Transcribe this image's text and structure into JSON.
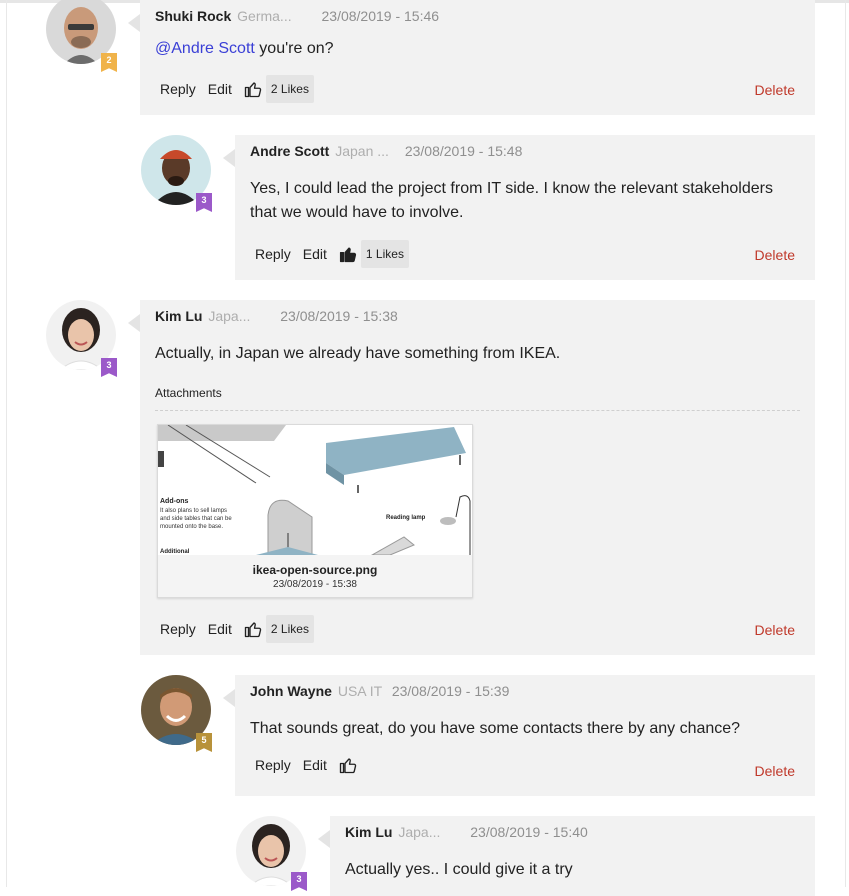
{
  "comments": [
    {
      "author": "Shuki Rock",
      "location": "Germa...",
      "date": "23/08/2019 - 15:46",
      "badge": "2",
      "mention": "@Andre Scott",
      "text": " you're on?",
      "reply": "Reply",
      "edit": "Edit",
      "likes": "2 Likes",
      "delete": "Delete"
    },
    {
      "author": "Andre Scott",
      "location": "Japan ...",
      "date": "23/08/2019 - 15:48",
      "badge": "3",
      "text_line1": "Yes, I could lead the project from IT side. I know the relevant stakeholders",
      "text_line2": "that we would have to involve.",
      "reply": "Reply",
      "edit": "Edit",
      "likes": "1 Likes",
      "delete": "Delete"
    },
    {
      "author": "Kim Lu",
      "location": "Japa...",
      "date": "23/08/2019 - 15:38",
      "badge": "3",
      "text": "Actually, in Japan we already have something from IKEA.",
      "attachments_label": "Attachments",
      "attachment": {
        "file_name": "ikea-open-source.png",
        "file_date": "23/08/2019 - 15:38",
        "thumb_addons_title": "Add-ons",
        "thumb_addons_line1": "It also plans to sell lamps",
        "thumb_addons_line2": "and side tables that can be",
        "thumb_addons_line3": "mounted onto the base.",
        "thumb_additional": "Additional",
        "thumb_reading_lamp": "Reading lamp"
      },
      "reply": "Reply",
      "edit": "Edit",
      "likes": "2 Likes",
      "delete": "Delete"
    },
    {
      "author": "John Wayne",
      "location": "USA IT",
      "date": "23/08/2019 - 15:39",
      "badge": "5",
      "text": "That sounds great, do you have some contacts there by any chance?",
      "reply": "Reply",
      "edit": "Edit",
      "delete": "Delete"
    },
    {
      "author": "Kim Lu",
      "location": "Japa...",
      "date": "23/08/2019 - 15:40",
      "badge": "3",
      "text": "Actually yes.. I could give it a try"
    }
  ],
  "colors": {
    "bubble_bg": "#f2f2f2",
    "delete_red": "#c0392b",
    "mention_blue": "#3a3fd6",
    "badge_orange": "#f0b34a",
    "badge_purple": "#9b59c9",
    "badge_gold": "#b8923a"
  }
}
